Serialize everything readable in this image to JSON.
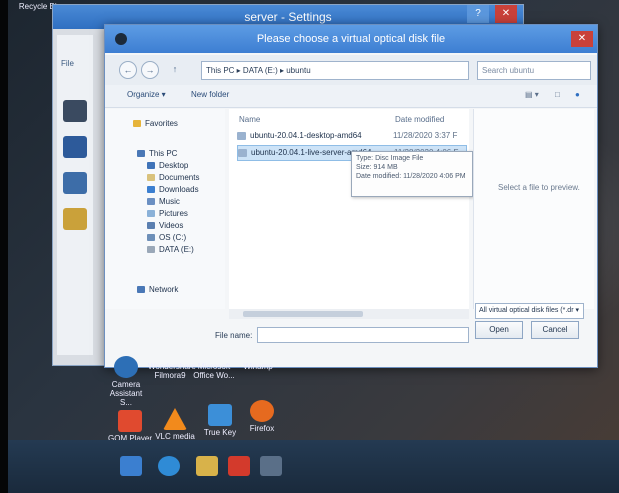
{
  "desktop": {
    "recycle_bin": "Recycle Bin",
    "icons": [
      {
        "label": "Camera Assistant S...",
        "color": "#2d6fb6"
      },
      {
        "label": "Wondershare Filmora9",
        "color": "#1fa3b8"
      },
      {
        "label": "Microsoft Office Wo...",
        "color": "#2b579a"
      },
      {
        "label": "Winamp",
        "color": "#3b3b3b"
      },
      {
        "label": "GOM Player",
        "color": "#e04a2f"
      },
      {
        "label": "VLC media player",
        "color": "#f28a1c"
      },
      {
        "label": "True Key",
        "color": "#3c8fd8"
      },
      {
        "label": "Firefox",
        "color": "#e66a1f"
      }
    ]
  },
  "background_window": {
    "title": "server - Settings",
    "file_tab": "File"
  },
  "dialog": {
    "title": "Please choose a virtual optical disk file",
    "close_glyph": "✕",
    "address": {
      "back_glyph": "←",
      "forward_glyph": "→",
      "up_glyph": "↑",
      "path": "This PC  ▸  DATA (E:)  ▸  ubuntu",
      "search_placeholder": "Search ubuntu"
    },
    "toolbar": {
      "organize": "Organize ▾",
      "new_folder": "New folder"
    },
    "nav": {
      "favorites": "Favorites",
      "this_pc": "This PC",
      "items": [
        "Desktop",
        "Documents",
        "Downloads",
        "Music",
        "Pictures",
        "Videos",
        "OS (C:)",
        "DATA (E:)"
      ],
      "network": "Network"
    },
    "columns": {
      "name": "Name",
      "date_modified": "Date modified"
    },
    "files": [
      {
        "name": "ubuntu-20.04.1-desktop-amd64",
        "date": "11/28/2020 3:37 F"
      },
      {
        "name": "ubuntu-20.04.1-live-server-amd64",
        "date": "11/28/2020 4:06 F"
      }
    ],
    "tooltip": {
      "type": "Type: Disc Image File",
      "size": "Size: 914 MB",
      "modified": "Date modified: 11/28/2020 4:06 PM"
    },
    "preview_text": "Select a file to preview.",
    "file_name_label": "File name:",
    "file_name_value": "",
    "file_type": "All virtual optical disk files (*.dr ▾",
    "open_button": "Open",
    "cancel_button": "Cancel"
  }
}
